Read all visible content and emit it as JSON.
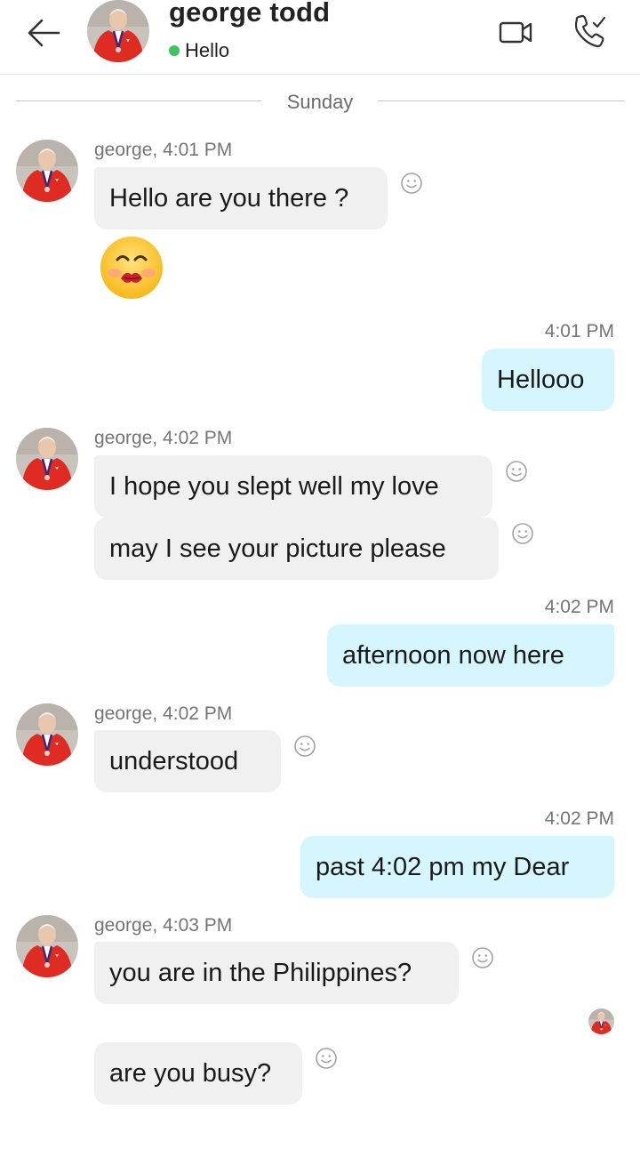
{
  "header": {
    "contact_name": "george todd",
    "status_text": "Hello",
    "status_color": "#3cc45f",
    "icons": [
      "back-arrow-icon",
      "video-call-icon",
      "phone-call-icon"
    ]
  },
  "day_divider": "Sunday",
  "colors": {
    "incoming_bubble": "#f0f0f0",
    "outgoing_bubble": "#d6f6fe"
  },
  "messages": [
    {
      "meta": "george, 4:01 PM",
      "text": "Hello are you there ?"
    },
    {
      "emoji": "kissing-face-emoji"
    },
    {
      "meta": "4:01 PM",
      "text": "Hellooo"
    },
    {
      "meta": "george, 4:02 PM",
      "text": "I hope you slept well my love"
    },
    {
      "text": "may I see your picture please"
    },
    {
      "meta": "4:02 PM",
      "text": "afternoon now here"
    },
    {
      "meta": "george, 4:02 PM",
      "text": "understood"
    },
    {
      "meta": "4:02 PM",
      "text": "past 4:02 pm my Dear"
    },
    {
      "meta": "george, 4:03 PM",
      "text": "you are in the Philippines?"
    },
    {
      "text": "are you busy?"
    }
  ]
}
